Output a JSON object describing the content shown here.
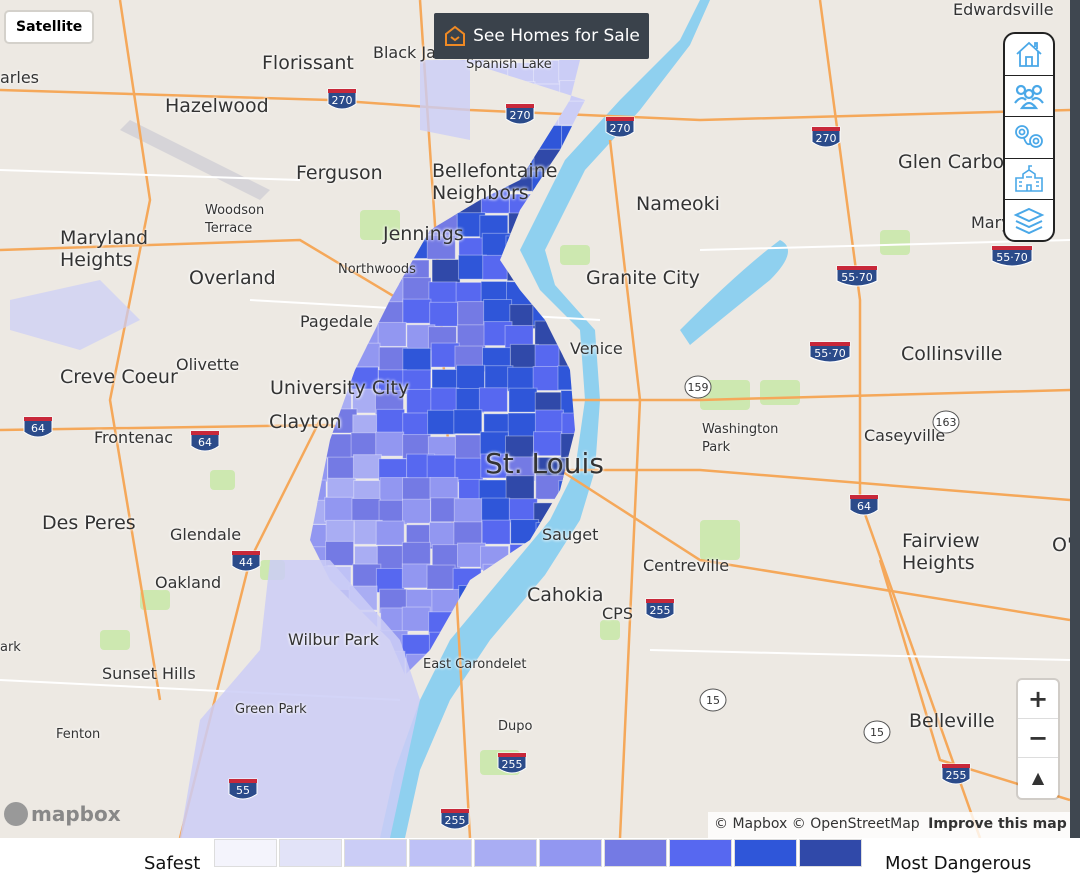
{
  "map": {
    "satellite_button": "Satellite",
    "homes_button": "See Homes for Sale",
    "toolbar": [
      {
        "icon": "home-icon"
      },
      {
        "icon": "people-icon"
      },
      {
        "icon": "handcuffs-icon"
      },
      {
        "icon": "school-icon"
      },
      {
        "icon": "layers-icon"
      }
    ],
    "zoom_in": "+",
    "zoom_out": "−",
    "compass": "▲",
    "attribution": {
      "mapbox": "© Mapbox",
      "osm": "© OpenStreetMap",
      "improve": "Improve this map"
    },
    "logo": "mapbox",
    "places": [
      "Edwardsville",
      "arles",
      "Florissant",
      "Black Jack",
      "Spanish Lake",
      "Hazelwood",
      "Ferguson",
      "Bellefontaine Neighbors",
      "Nameoki",
      "Glen Carbon",
      "Woodson Terrace",
      "Maryland Heights",
      "Jennings",
      "Northwoods",
      "Overland",
      "Granite City",
      "Mary",
      "Pagedale",
      "Venice",
      "Collinsville",
      "Olivette",
      "Creve Coeur",
      "University City",
      "Clayton",
      "Frontenac",
      "Washington Park",
      "Caseyville",
      "St. Louis",
      "Des Peres",
      "Glendale",
      "Sauget",
      "Centreville",
      "Fairview Heights",
      "O'",
      "Oakland",
      "Cahokia",
      "CPS",
      "Wilbur Park",
      "Sunset Hills",
      "East Carondelet",
      "Green Park",
      "Fenton",
      "Dupo",
      "Belleville",
      "ark"
    ],
    "shields": [
      "270",
      "270",
      "270",
      "270",
      "64",
      "64",
      "64",
      "44",
      "255",
      "255",
      "255",
      "55·70",
      "55·70",
      "55·70",
      "159",
      "163",
      "15",
      "15",
      "255",
      "55"
    ]
  },
  "legend": {
    "low": "Safest",
    "high": "Most Dangerous",
    "colors": [
      "#f4f4fc",
      "#e2e3f8",
      "#cbcdf6",
      "#bec1f6",
      "#a9adf3",
      "#9297f1",
      "#747ae4",
      "#5768f0",
      "#2f56d9",
      "#3049a9"
    ]
  }
}
